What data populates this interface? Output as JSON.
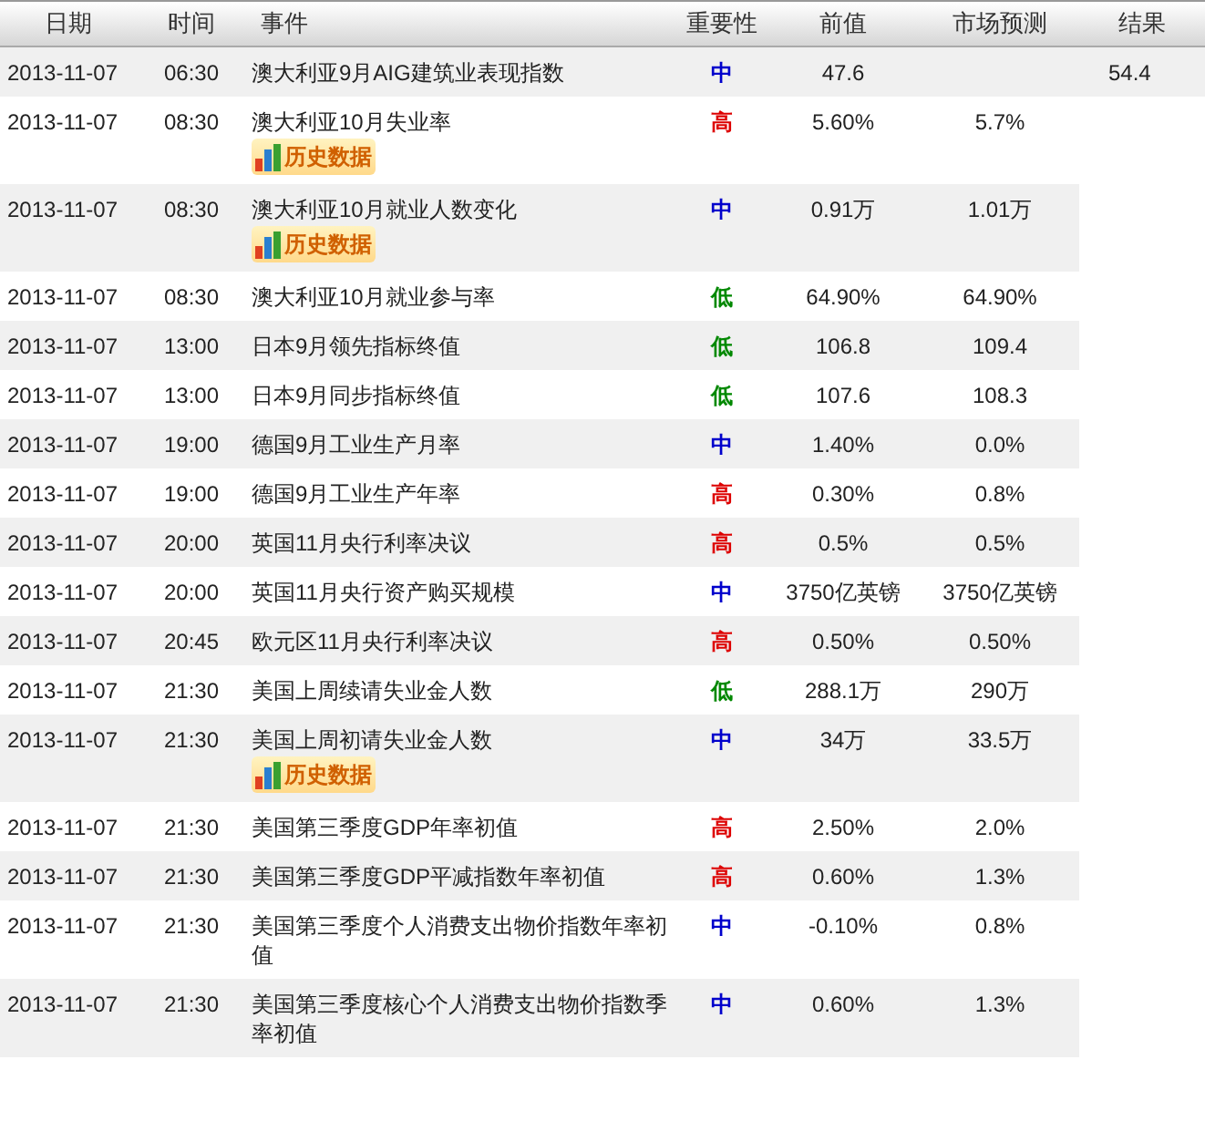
{
  "table": {
    "columns": [
      "日期",
      "时间",
      "事件",
      "重要性",
      "前值",
      "市场预测",
      "结果"
    ],
    "rows": [
      {
        "date": "2013-11-07",
        "time": "06:30",
        "event": "澳大利亚9月AIG建筑业表现指数",
        "importance": {
          "text": "中",
          "color": "#0000cc"
        },
        "previous": "47.6",
        "forecast": "",
        "result": "54.4"
      },
      {
        "date": "2013-11-07",
        "time": "08:30",
        "event": "澳大利亚10月失业率",
        "history_button": "历史数据",
        "importance": {
          "text": "高",
          "color": "#dd0000"
        },
        "previous": "5.60%",
        "forecast": "5.7%"
      },
      {
        "date": "2013-11-07",
        "time": "08:30",
        "event": "澳大利亚10月就业人数变化",
        "history_button": "历史数据",
        "importance": {
          "text": "中",
          "color": "#0000cc"
        },
        "previous": "0.91万",
        "forecast": "1.01万"
      },
      {
        "date": "2013-11-07",
        "time": "08:30",
        "event": "澳大利亚10月就业参与率",
        "importance": {
          "text": "低",
          "color": "#008800"
        },
        "previous": "64.90%",
        "forecast": "64.90%"
      },
      {
        "date": "2013-11-07",
        "time": "13:00",
        "event": "日本9月领先指标终值",
        "importance": {
          "text": "低",
          "color": "#008800"
        },
        "previous": "106.8",
        "forecast": "109.4"
      },
      {
        "date": "2013-11-07",
        "time": "13:00",
        "event": "日本9月同步指标终值",
        "importance": {
          "text": "低",
          "color": "#008800"
        },
        "previous": "107.6",
        "forecast": "108.3"
      },
      {
        "date": "2013-11-07",
        "time": "19:00",
        "event": "德国9月工业生产月率",
        "importance": {
          "text": "中",
          "color": "#0000cc"
        },
        "previous": "1.40%",
        "forecast": "0.0%"
      },
      {
        "date": "2013-11-07",
        "time": "19:00",
        "event": "德国9月工业生产年率",
        "importance": {
          "text": "高",
          "color": "#dd0000"
        },
        "previous": "0.30%",
        "forecast": "0.8%"
      },
      {
        "date": "2013-11-07",
        "time": "20:00",
        "event": "英国11月央行利率决议",
        "importance": {
          "text": "高",
          "color": "#dd0000"
        },
        "previous": "0.5%",
        "forecast": "0.5%"
      },
      {
        "date": "2013-11-07",
        "time": "20:00",
        "event": "英国11月央行资产购买规模",
        "importance": {
          "text": "中",
          "color": "#0000cc"
        },
        "previous": "3750亿英镑",
        "forecast": "3750亿英镑"
      },
      {
        "date": "2013-11-07",
        "time": "20:45",
        "event": "欧元区11月央行利率决议",
        "importance": {
          "text": "高",
          "color": "#dd0000"
        },
        "previous": "0.50%",
        "forecast": "0.50%"
      },
      {
        "date": "2013-11-07",
        "time": "21:30",
        "event": "美国上周续请失业金人数",
        "importance": {
          "text": "低",
          "color": "#008800"
        },
        "previous": "288.1万",
        "forecast": "290万"
      },
      {
        "date": "2013-11-07",
        "time": "21:30",
        "event": "美国上周初请失业金人数",
        "history_button": "历史数据",
        "importance": {
          "text": "中",
          "color": "#0000cc"
        },
        "previous": "34万",
        "forecast": "33.5万"
      },
      {
        "date": "2013-11-07",
        "time": "21:30",
        "event": "美国第三季度GDP年率初值",
        "importance": {
          "text": "高",
          "color": "#dd0000"
        },
        "previous": "2.50%",
        "forecast": "2.0%"
      },
      {
        "date": "2013-11-07",
        "time": "21:30",
        "event": "美国第三季度GDP平减指数年率初值",
        "importance": {
          "text": "高",
          "color": "#dd0000"
        },
        "previous": "0.60%",
        "forecast": "1.3%"
      },
      {
        "date": "2013-11-07",
        "time": "21:30",
        "event": "美国第三季度个人消费支出物价指数年率初值",
        "importance": {
          "text": "中",
          "color": "#0000cc"
        },
        "previous": "-0.10%",
        "forecast": "0.8%"
      },
      {
        "date": "2013-11-07",
        "time": "21:30",
        "event": "美国第三季度核心个人消费支出物价指数季率初值",
        "importance": {
          "text": "中",
          "color": "#0000cc"
        },
        "previous": "0.60%",
        "forecast": "1.3%"
      }
    ]
  }
}
